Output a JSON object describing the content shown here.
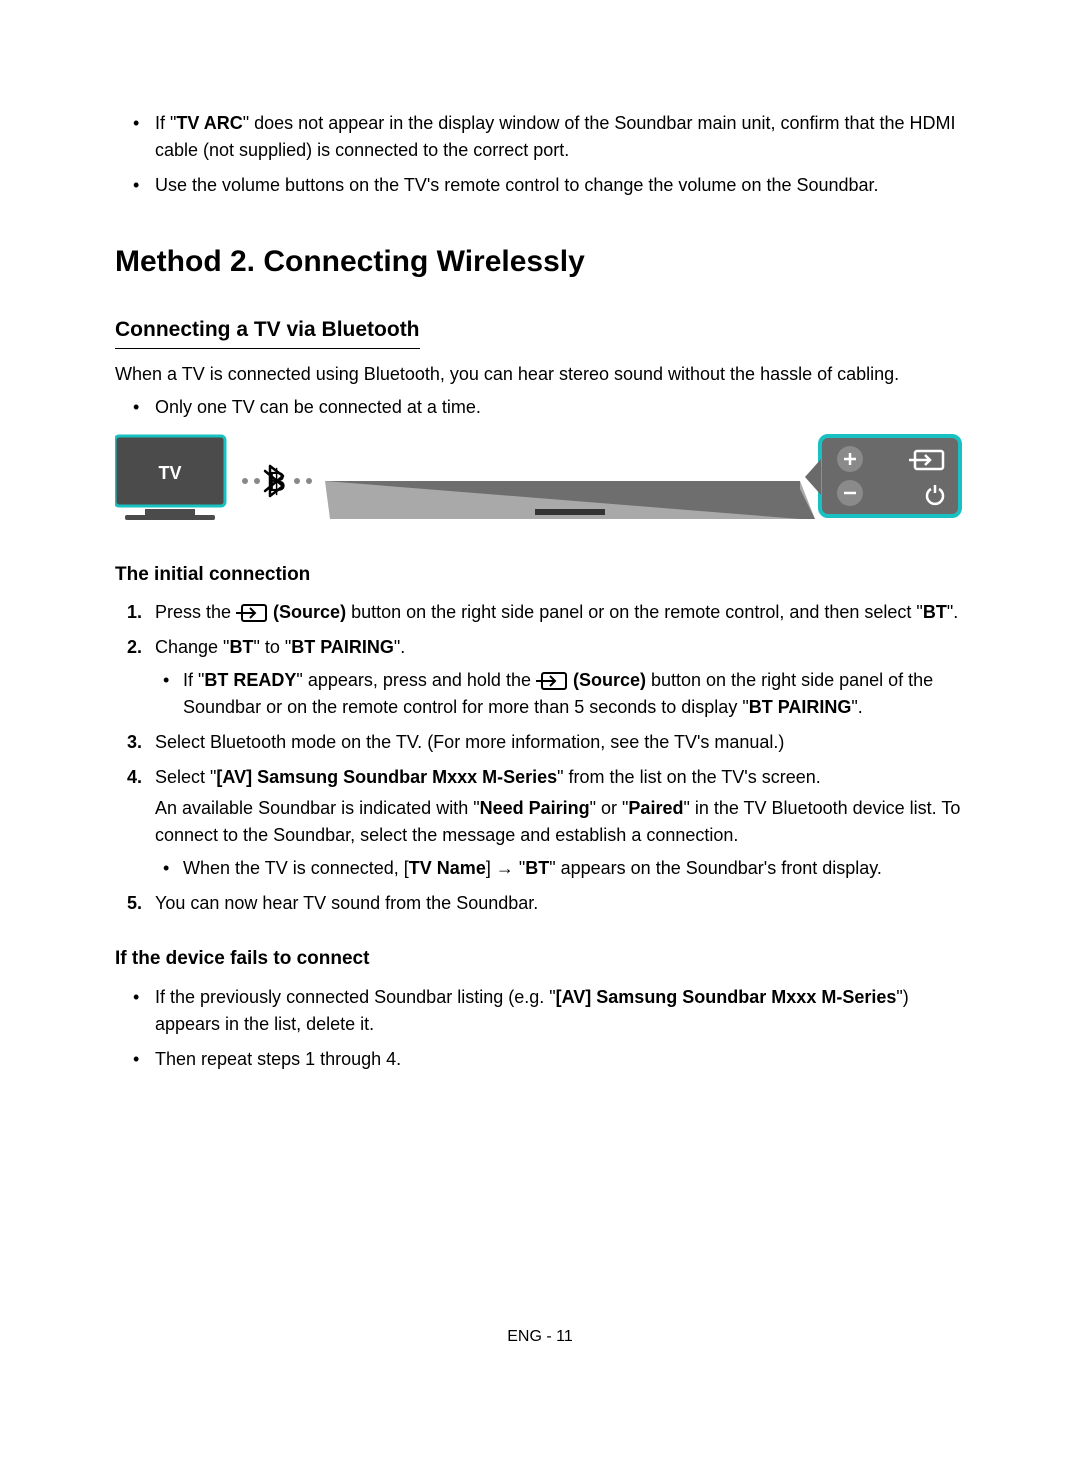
{
  "top_bullets": {
    "b1_pre": "If \"",
    "b1_bold": "TV ARC",
    "b1_post": "\" does not appear in the display window of the Soundbar main unit, confirm that the HDMI cable (not supplied) is connected to the correct port.",
    "b2": "Use the volume buttons on the TV's remote control to change the volume on the Soundbar."
  },
  "method_title": "Method 2. Connecting Wirelessly",
  "bt_subheading": "Connecting a TV via Bluetooth",
  "bt_intro": "When a TV is connected using Bluetooth, you can hear stereo sound without the hassle of cabling.",
  "bt_note": "Only one TV can be connected at a time.",
  "diagram": {
    "tv_label": "TV"
  },
  "initial_heading": "The initial connection",
  "steps": {
    "s1_pre": "Press the ",
    "s1_source": " (Source)",
    "s1_mid": " button on the right side panel or on the remote control, and then select \"",
    "s1_bt": "BT",
    "s1_end": "\".",
    "s2_pre": "Change \"",
    "s2_bt": "BT",
    "s2_mid": "\" to \"",
    "s2_pair": "BT PAIRING",
    "s2_end": "\".",
    "s2_sub_pre": "If \"",
    "s2_sub_ready": "BT READY",
    "s2_sub_mid1": "\" appears, press and hold the ",
    "s2_sub_source": " (Source)",
    "s2_sub_mid2": " button on the right side panel of the Soundbar or on the remote control for more than 5 seconds to display \"",
    "s2_sub_pair": "BT PAIRING",
    "s2_sub_end": "\".",
    "s3": "Select Bluetooth mode on the TV. (For more information, see the TV's manual.)",
    "s4_pre": "Select \"",
    "s4_dev": "[AV] Samsung Soundbar Mxxx M-Series",
    "s4_post": "\" from the list on the TV's screen.",
    "s4_line2_pre": "An available Soundbar is indicated with \"",
    "s4_need": "Need Pairing",
    "s4_or": "\" or \"",
    "s4_paired": "Paired",
    "s4_line2_post": "\" in the TV Bluetooth device list. To connect to the Soundbar, select the message and establish a connection.",
    "s4_sub_pre": "When the TV is connected, [",
    "s4_sub_tvname": "TV Name",
    "s4_sub_mid": "] → \"",
    "s4_sub_bt": "BT",
    "s4_sub_end": "\" appears on the Soundbar's front display.",
    "s5": "You can now hear TV sound from the Soundbar."
  },
  "fail_heading": "If the device fails to connect",
  "fail": {
    "b1_pre": "If the previously connected Soundbar listing (e.g. \"",
    "b1_dev": "[AV] Samsung Soundbar Mxxx M-Series",
    "b1_post": "\") appears in the list, delete it.",
    "b2": "Then repeat steps 1 through 4."
  },
  "footer": "ENG - 11"
}
